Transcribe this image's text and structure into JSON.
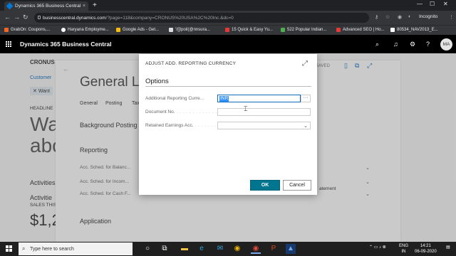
{
  "browser": {
    "tab_title": "Dynamics 365 Business Central",
    "tab_close": "×",
    "new_tab": "+",
    "url_host": "businesscentral.dynamics.com",
    "url_path": "/?page=118&company=CRONUS%20USA%2C%20Inc.&dc=0",
    "incognito_label": "Incognito",
    "bookmarks": [
      {
        "label": "GrabOn: Coupons,...",
        "icon_color": "#f26522"
      },
      {
        "label": "Haryana Employme...",
        "icon_color": "#ffffff"
      },
      {
        "label": "Google Ads - Get...",
        "icon_color": "#fbbc05"
      },
      {
        "label": "'/{[tpoil(@nnsura...",
        "icon_color": "#dddddd"
      },
      {
        "label": "15 Quick & Easy Yu...",
        "icon_color": "#e53935"
      },
      {
        "label": "522 Popular Indian...",
        "icon_color": "#4caf50"
      },
      {
        "label": "Advanced SEO | Ho...",
        "icon_color": "#e53935"
      },
      {
        "label": "80534_NAV2013_E...",
        "icon_color": "#ffffff"
      }
    ]
  },
  "app": {
    "title": "Dynamics 365 Business Central",
    "avatar_initials": "MA"
  },
  "background": {
    "company": "CRONUS",
    "breadcrumb": "Customer",
    "filter_chip": "Want",
    "page_title": "General Le",
    "tabs": [
      "General",
      "Posting",
      "Tax"
    ],
    "headline_label": "HEADLINE",
    "headline_text_1": "Wa",
    "headline_text_2": "abc",
    "background_posting": "Background Posting",
    "reporting": "Reporting",
    "acc_sched_balance": "Acc. Sched. for Balanc...",
    "acc_sched_income": "Acc. Sched. for Incom...",
    "acc_sched_cash": "Acc. Sched. for Cash F...",
    "saved_status": "SAVED",
    "activities": "Activities",
    "activities_2": "Activitie",
    "sales_this": "SALES THIS",
    "amount": "$1,2",
    "application": "Application",
    "statement_fragment": "atement"
  },
  "dialog": {
    "title": "ADJUST ADD. REPORTING CURRENCY",
    "section": "Options",
    "fields": [
      {
        "label": "Additional Reporting Curre...",
        "value": "INR"
      },
      {
        "label": "Document No.",
        "value": ""
      },
      {
        "label": "Retained Earnings Acc.",
        "value": ""
      }
    ],
    "lookup_label": "···",
    "ok_label": "OK",
    "cancel_label": "Cancel"
  },
  "taskbar": {
    "search_placeholder": "Type here to search",
    "language": "ENG",
    "region": "IN",
    "time": "14:21",
    "date": "06-09-2020"
  }
}
